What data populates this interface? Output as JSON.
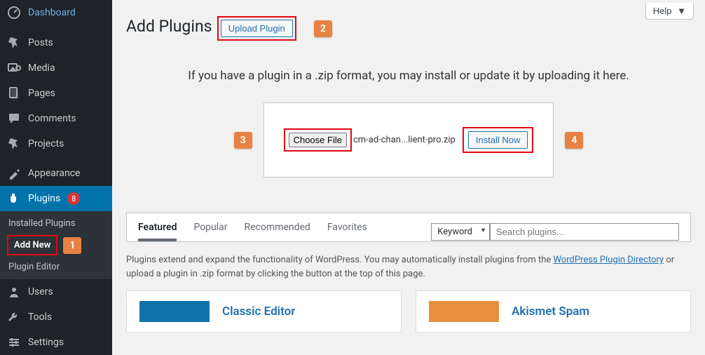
{
  "sidebar": {
    "items": [
      {
        "label": "Dashboard"
      },
      {
        "label": "Posts"
      },
      {
        "label": "Media"
      },
      {
        "label": "Pages"
      },
      {
        "label": "Comments"
      },
      {
        "label": "Projects"
      },
      {
        "label": "Appearance"
      },
      {
        "label": "Plugins",
        "badge": "8"
      },
      {
        "label": "Users"
      },
      {
        "label": "Tools"
      },
      {
        "label": "Settings"
      }
    ],
    "plugin_sub": [
      {
        "label": "Installed Plugins"
      },
      {
        "label": "Add New"
      },
      {
        "label": "Plugin Editor"
      }
    ]
  },
  "annotations": {
    "b1": "1",
    "b2": "2",
    "b3": "3",
    "b4": "4"
  },
  "header": {
    "help": "Help",
    "title": "Add Plugins",
    "upload_btn": "Upload Plugin"
  },
  "upload": {
    "desc": "If you have a plugin in a .zip format, you may install or update it by uploading it here.",
    "choose_file": "Choose File",
    "filename": "cm-ad-chan...lient-pro.zip",
    "install_now": "Install Now"
  },
  "browse": {
    "tabs": [
      "Featured",
      "Popular",
      "Recommended",
      "Favorites"
    ],
    "keyword": "Keyword",
    "search_placeholder": "Search plugins...",
    "desc_pre": "Plugins extend and expand the functionality of WordPress. You may automatically install plugins from the ",
    "desc_link": "WordPress Plugin Directory",
    "desc_post": " or upload a plugin in .zip format by clicking the button at the top of this page."
  },
  "cards": [
    {
      "title": "Classic Editor",
      "thumb_bg": "#1073aa"
    },
    {
      "title": "Akismet Spam",
      "thumb_bg": "#e78f3d"
    }
  ]
}
